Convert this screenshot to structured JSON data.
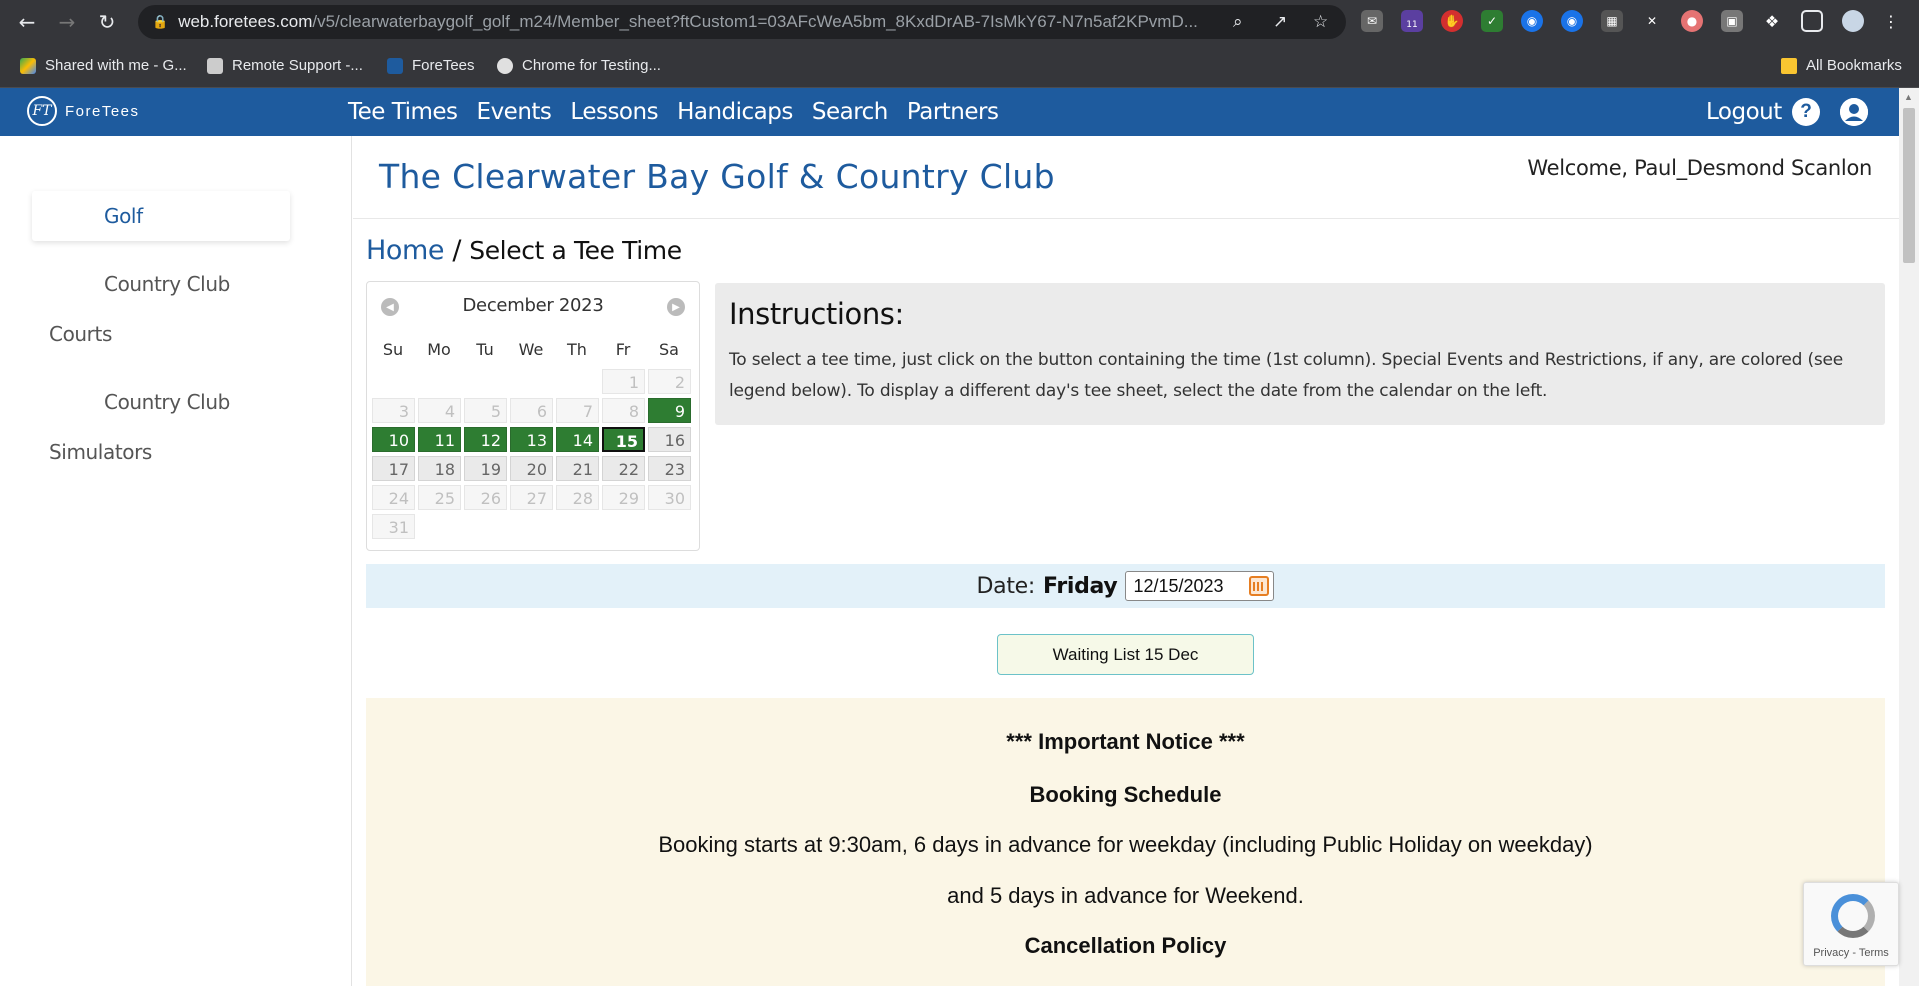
{
  "browser": {
    "url_host": "web.foretees.com",
    "url_path": "/v5/clearwaterbaygolf_golf_m24/Member_sheet?ftCustom1=03AFcWeA5bm_8KxdDrAB-7IsMkY67-N7n5af2KPvmD...",
    "extension_badge": "11",
    "bookmarks": [
      "Shared with me - G...",
      "Remote Support -...",
      "ForeTees",
      "Chrome for Testing..."
    ],
    "all_bookmarks": "All Bookmarks"
  },
  "header": {
    "logo_text": "ForeTees",
    "logo_mark": "FT",
    "nav": [
      "Tee Times",
      "Events",
      "Lessons",
      "Handicaps",
      "Search",
      "Partners"
    ],
    "logout": "Logout",
    "help": "?"
  },
  "sidebar": {
    "items": [
      "Golf",
      "Country Club",
      "Courts",
      "Country Club",
      "Simulators"
    ]
  },
  "page": {
    "club_name": "The Clearwater Bay Golf & Country Club",
    "welcome": "Welcome,  Paul_Desmond Scanlon",
    "breadcrumb_home": "Home",
    "breadcrumb_sep": "/",
    "breadcrumb_current": "Select a Tee Time"
  },
  "calendar": {
    "month": "December 2023",
    "dow": [
      "Su",
      "Mo",
      "Tu",
      "We",
      "Th",
      "Fr",
      "Sa"
    ],
    "weeks": [
      [
        null,
        null,
        null,
        null,
        null,
        {
          "d": "1",
          "s": "dis"
        },
        {
          "d": "2",
          "s": "dis"
        }
      ],
      [
        {
          "d": "3",
          "s": "dis"
        },
        {
          "d": "4",
          "s": "dis"
        },
        {
          "d": "5",
          "s": "dis"
        },
        {
          "d": "6",
          "s": "dis"
        },
        {
          "d": "7",
          "s": "dis"
        },
        {
          "d": "8",
          "s": "dis"
        },
        {
          "d": "9",
          "s": "act"
        }
      ],
      [
        {
          "d": "10",
          "s": "act"
        },
        {
          "d": "11",
          "s": "act"
        },
        {
          "d": "12",
          "s": "act"
        },
        {
          "d": "13",
          "s": "act"
        },
        {
          "d": "14",
          "s": "act"
        },
        {
          "d": "15",
          "s": "sel"
        },
        {
          "d": "16",
          "s": "fut"
        }
      ],
      [
        {
          "d": "17",
          "s": "fut"
        },
        {
          "d": "18",
          "s": "fut"
        },
        {
          "d": "19",
          "s": "fut"
        },
        {
          "d": "20",
          "s": "fut"
        },
        {
          "d": "21",
          "s": "fut"
        },
        {
          "d": "22",
          "s": "fut"
        },
        {
          "d": "23",
          "s": "fut"
        }
      ],
      [
        {
          "d": "24",
          "s": "dis"
        },
        {
          "d": "25",
          "s": "dis"
        },
        {
          "d": "26",
          "s": "dis"
        },
        {
          "d": "27",
          "s": "dis"
        },
        {
          "d": "28",
          "s": "dis"
        },
        {
          "d": "29",
          "s": "dis"
        },
        {
          "d": "30",
          "s": "dis"
        }
      ],
      [
        {
          "d": "31",
          "s": "dis"
        },
        null,
        null,
        null,
        null,
        null,
        null
      ]
    ]
  },
  "instructions": {
    "title": "Instructions:",
    "body": "To select a tee time, just click on the button containing the time (1st column). Special Events and Restrictions, if any, are colored (see legend below). To display a different day's tee sheet, select the date from the calendar on the left."
  },
  "datebar": {
    "label": "Date:",
    "day_name": "Friday",
    "date_value": "12/15/2023"
  },
  "waiting_list": "Waiting List 15 Dec",
  "notice": {
    "title": "*** Important Notice ***",
    "booking_heading": "Booking Schedule",
    "booking_line1": "Booking starts at 9:30am, 6 days in advance for weekday (including Public Holiday on weekday)",
    "booking_line2": "and 5 days in advance for Weekend.",
    "cancel_heading": "Cancellation Policy"
  },
  "recaptcha": {
    "text": "Privacy - Terms"
  },
  "colors": {
    "brand_blue": "#1e5b9e",
    "available_green": "#2e7d32"
  }
}
